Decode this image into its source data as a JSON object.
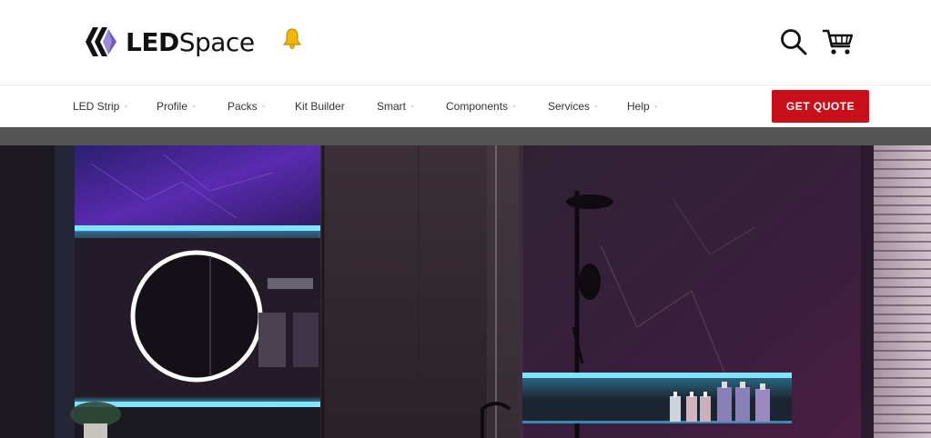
{
  "brand": {
    "name_bold": "LED",
    "name_regular": "Space"
  },
  "nav": {
    "items": [
      {
        "label": "LED Strip",
        "has_menu": true
      },
      {
        "label": "Profile",
        "has_menu": true
      },
      {
        "label": "Packs",
        "has_menu": true
      },
      {
        "label": "Kit Builder",
        "has_menu": false
      },
      {
        "label": "Smart",
        "has_menu": true
      },
      {
        "label": "Components",
        "has_menu": true
      },
      {
        "label": "Services",
        "has_menu": true
      },
      {
        "label": "Help",
        "has_menu": true
      }
    ],
    "cta_label": "GET QUOTE"
  },
  "icons": {
    "bell": "bell-icon",
    "search": "search-icon",
    "cart": "cart-icon",
    "chevron": "chevron-down-icon"
  },
  "colors": {
    "cta": "#c8101a",
    "bell": "#f2b705",
    "led_glow": "#3fd0ff",
    "accent_purple": "#6a2bb8"
  }
}
